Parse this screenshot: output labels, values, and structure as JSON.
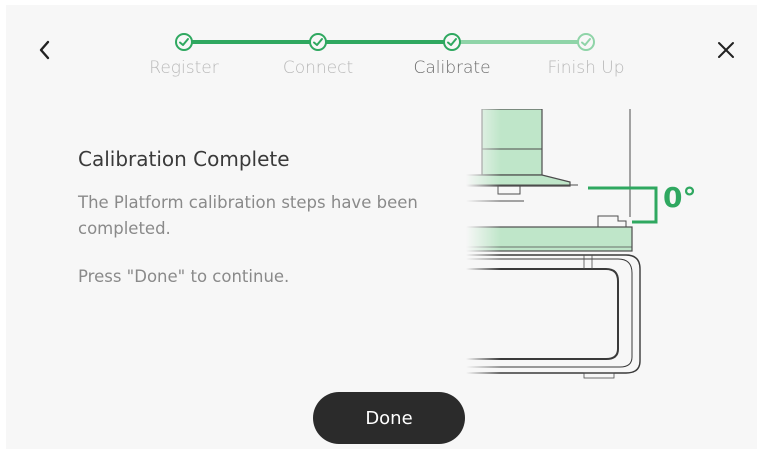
{
  "header": {
    "back_icon": "chevron-left-icon",
    "close_icon": "close-icon"
  },
  "stepper": {
    "steps": [
      {
        "label": "Register",
        "state": "complete"
      },
      {
        "label": "Connect",
        "state": "complete"
      },
      {
        "label": "Calibrate",
        "state": "active"
      },
      {
        "label": "Finish Up",
        "state": "upcoming"
      }
    ],
    "colors": {
      "done": "#2fa860",
      "pending": "#8fd4a8"
    }
  },
  "content": {
    "title": "Calibration Complete",
    "description": "The Platform calibration steps have been completed.",
    "hint": "Press \"Done\" to continue."
  },
  "illustration": {
    "angle_label": "0°",
    "accent_color": "#2fa860",
    "fill_color": "#bfe6c9"
  },
  "footer": {
    "done_label": "Done"
  }
}
